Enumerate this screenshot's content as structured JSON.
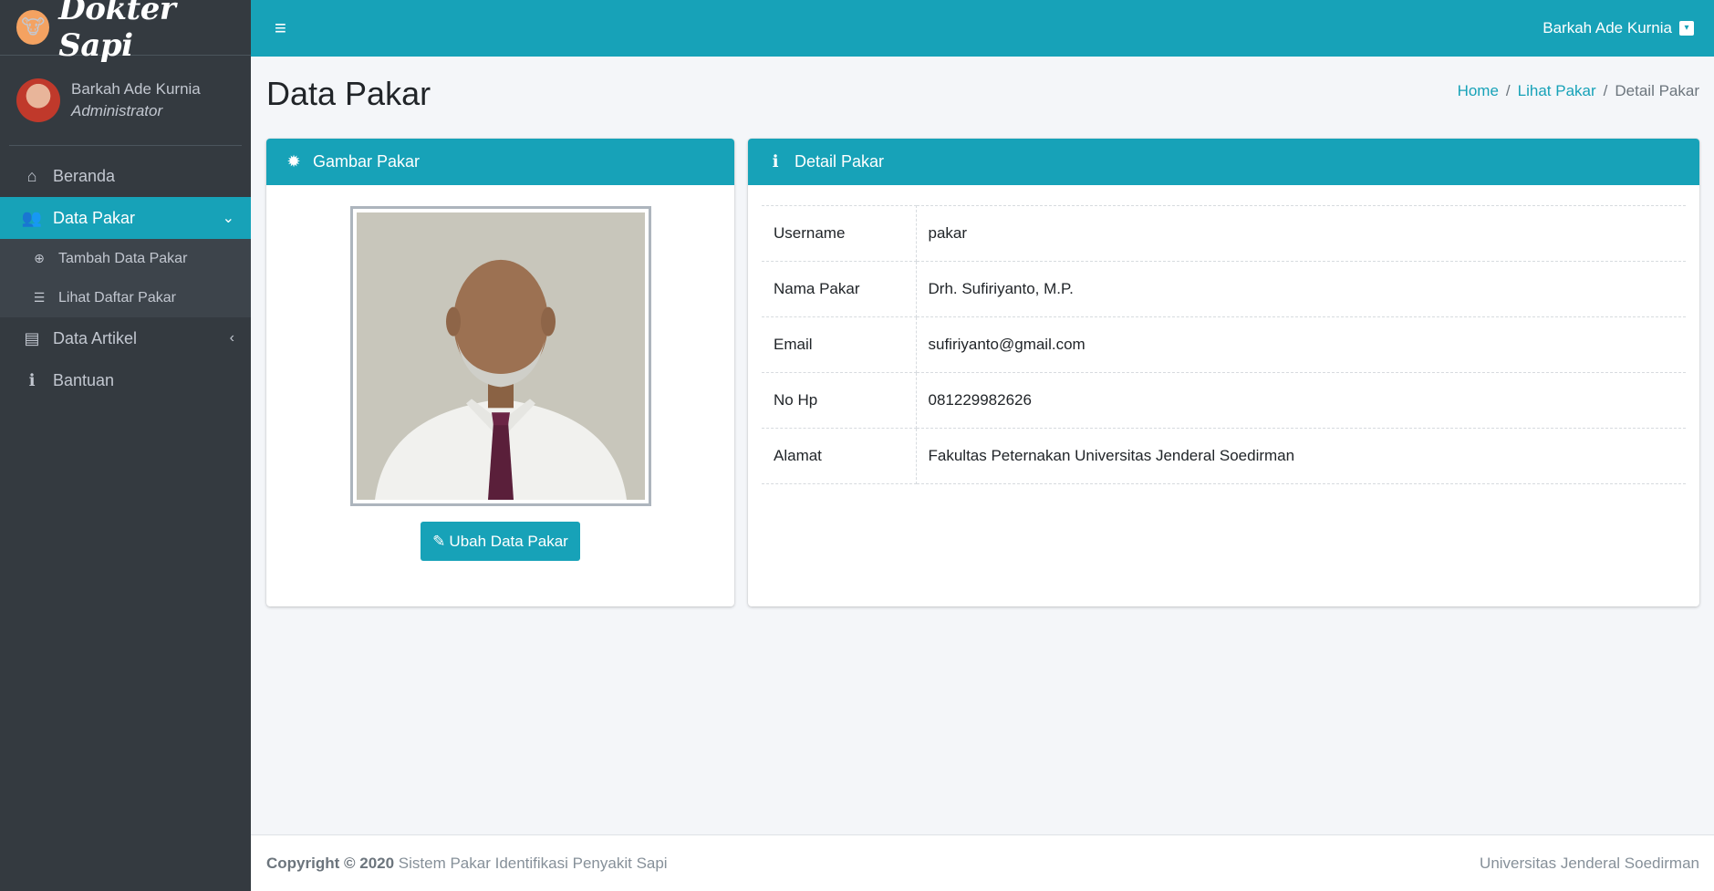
{
  "brand": {
    "name": "Dokter Sapi",
    "logo_icon": "🐮"
  },
  "user_panel": {
    "name": "Barkah Ade Kurnia",
    "role": "Administrator"
  },
  "sidebar": {
    "items": [
      {
        "label": "Beranda",
        "icon": "⌂"
      },
      {
        "label": "Data Pakar",
        "icon": "👥",
        "chevron": "⌄"
      },
      {
        "label": "Data Artikel",
        "icon": "▤",
        "chevron": "‹"
      },
      {
        "label": "Bantuan",
        "icon": "ℹ"
      }
    ],
    "subitems": [
      {
        "label": "Tambah Data Pakar",
        "icon": "⊕"
      },
      {
        "label": "Lihat Daftar Pakar",
        "icon": "☰"
      }
    ]
  },
  "topbar": {
    "menu_icon": "≡",
    "user_name": "Barkah Ade Kurnia",
    "caret": "▾"
  },
  "page": {
    "title": "Data Pakar"
  },
  "breadcrumb": {
    "home": "Home",
    "sep": "/",
    "lihat": "Lihat Pakar",
    "current": "Detail Pakar"
  },
  "card_image": {
    "title": "Gambar Pakar",
    "icon": "✹",
    "button_label": "Ubah Data Pakar",
    "button_icon": "✎"
  },
  "card_detail": {
    "title": "Detail Pakar",
    "icon": "ℹ",
    "rows": [
      {
        "label": "Username",
        "value": "pakar"
      },
      {
        "label": "Nama Pakar",
        "value": "Drh. Sufiriyanto, M.P."
      },
      {
        "label": "Email",
        "value": "sufiriyanto@gmail.com"
      },
      {
        "label": "No Hp",
        "value": "081229982626"
      },
      {
        "label": "Alamat",
        "value": "Fakultas Peternakan Universitas Jenderal Soedirman"
      }
    ]
  },
  "footer": {
    "copyright": "Copyright © 2020",
    "app": " Sistem Pakar Identifikasi Penyakit Sapi",
    "right": "Universitas Jenderal Soedirman"
  },
  "colors": {
    "accent": "#17a2b8",
    "sidebar": "#343a40"
  }
}
